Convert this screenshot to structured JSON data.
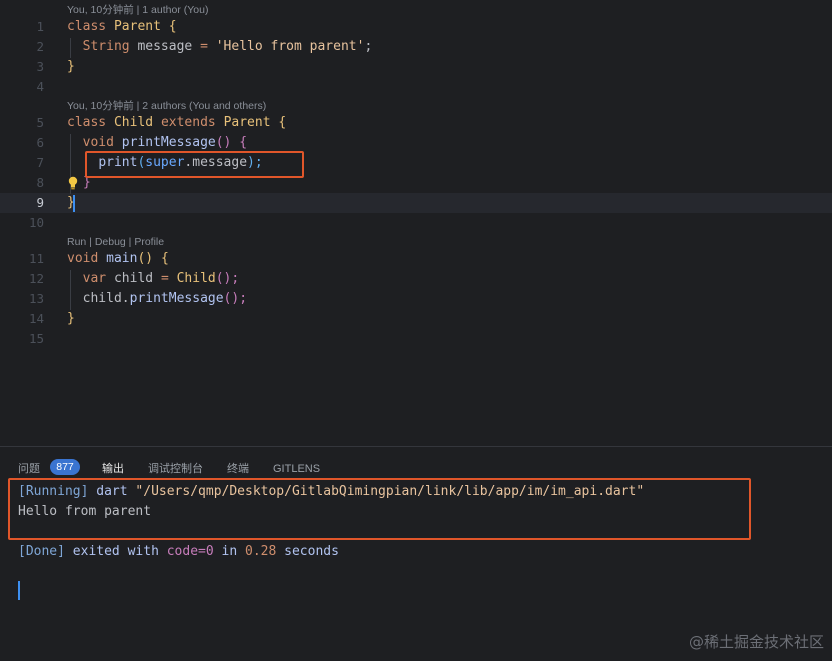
{
  "editor": {
    "lens1": "You, 10分钟前 | 1 author (You)",
    "lens2": "You, 10分钟前 | 2 authors (You and others)",
    "lens3": "Run | Debug | Profile",
    "line_numbers": [
      "1",
      "2",
      "3",
      "4",
      "5",
      "6",
      "7",
      "8",
      "9",
      "10",
      "11",
      "12",
      "13",
      "14",
      "15"
    ],
    "current_line": "9",
    "lines": {
      "l1": [
        "class",
        "Parent",
        "{"
      ],
      "l2": [
        "String",
        "message",
        "=",
        "'Hello from parent'",
        ";"
      ],
      "l3": [
        "}"
      ],
      "l5": [
        "class",
        "Child",
        "extends",
        "Parent",
        "{"
      ],
      "l6": [
        "void",
        "printMessage",
        "()",
        "{"
      ],
      "l7": [
        "print",
        "(",
        "super",
        ".message",
        ");"
      ],
      "l8": [
        "}"
      ],
      "l9": [
        "}"
      ],
      "l11": [
        "void",
        "main",
        "()",
        "{"
      ],
      "l12": [
        "var",
        "child",
        "=",
        "Child",
        "();"
      ],
      "l13": [
        "child.",
        "printMessage",
        "();"
      ],
      "l14": [
        "}"
      ]
    }
  },
  "panel": {
    "tabs": {
      "problems": "问题",
      "problems_count": "877",
      "output": "输出",
      "debug_console": "调试控制台",
      "terminal": "终端",
      "gitlens": "GITLENS"
    },
    "output": {
      "running_tag": "[Running]",
      "running_cmd": "dart",
      "running_path": "\"/Users/qmp/Desktop/GitlabQimingpian/link/lib/app/im/im_api.dart\"",
      "result": "Hello from parent",
      "done_tag": "[Done]",
      "done_text": "exited with",
      "done_code": "code=0",
      "done_in": "in",
      "done_time": "0.28",
      "done_seconds": "seconds"
    }
  },
  "watermark": "@稀土掘金技术社区",
  "colors": {
    "highlight_box": "#e0562a",
    "badge": "#3a74d0",
    "caret": "#3d8ff0"
  }
}
